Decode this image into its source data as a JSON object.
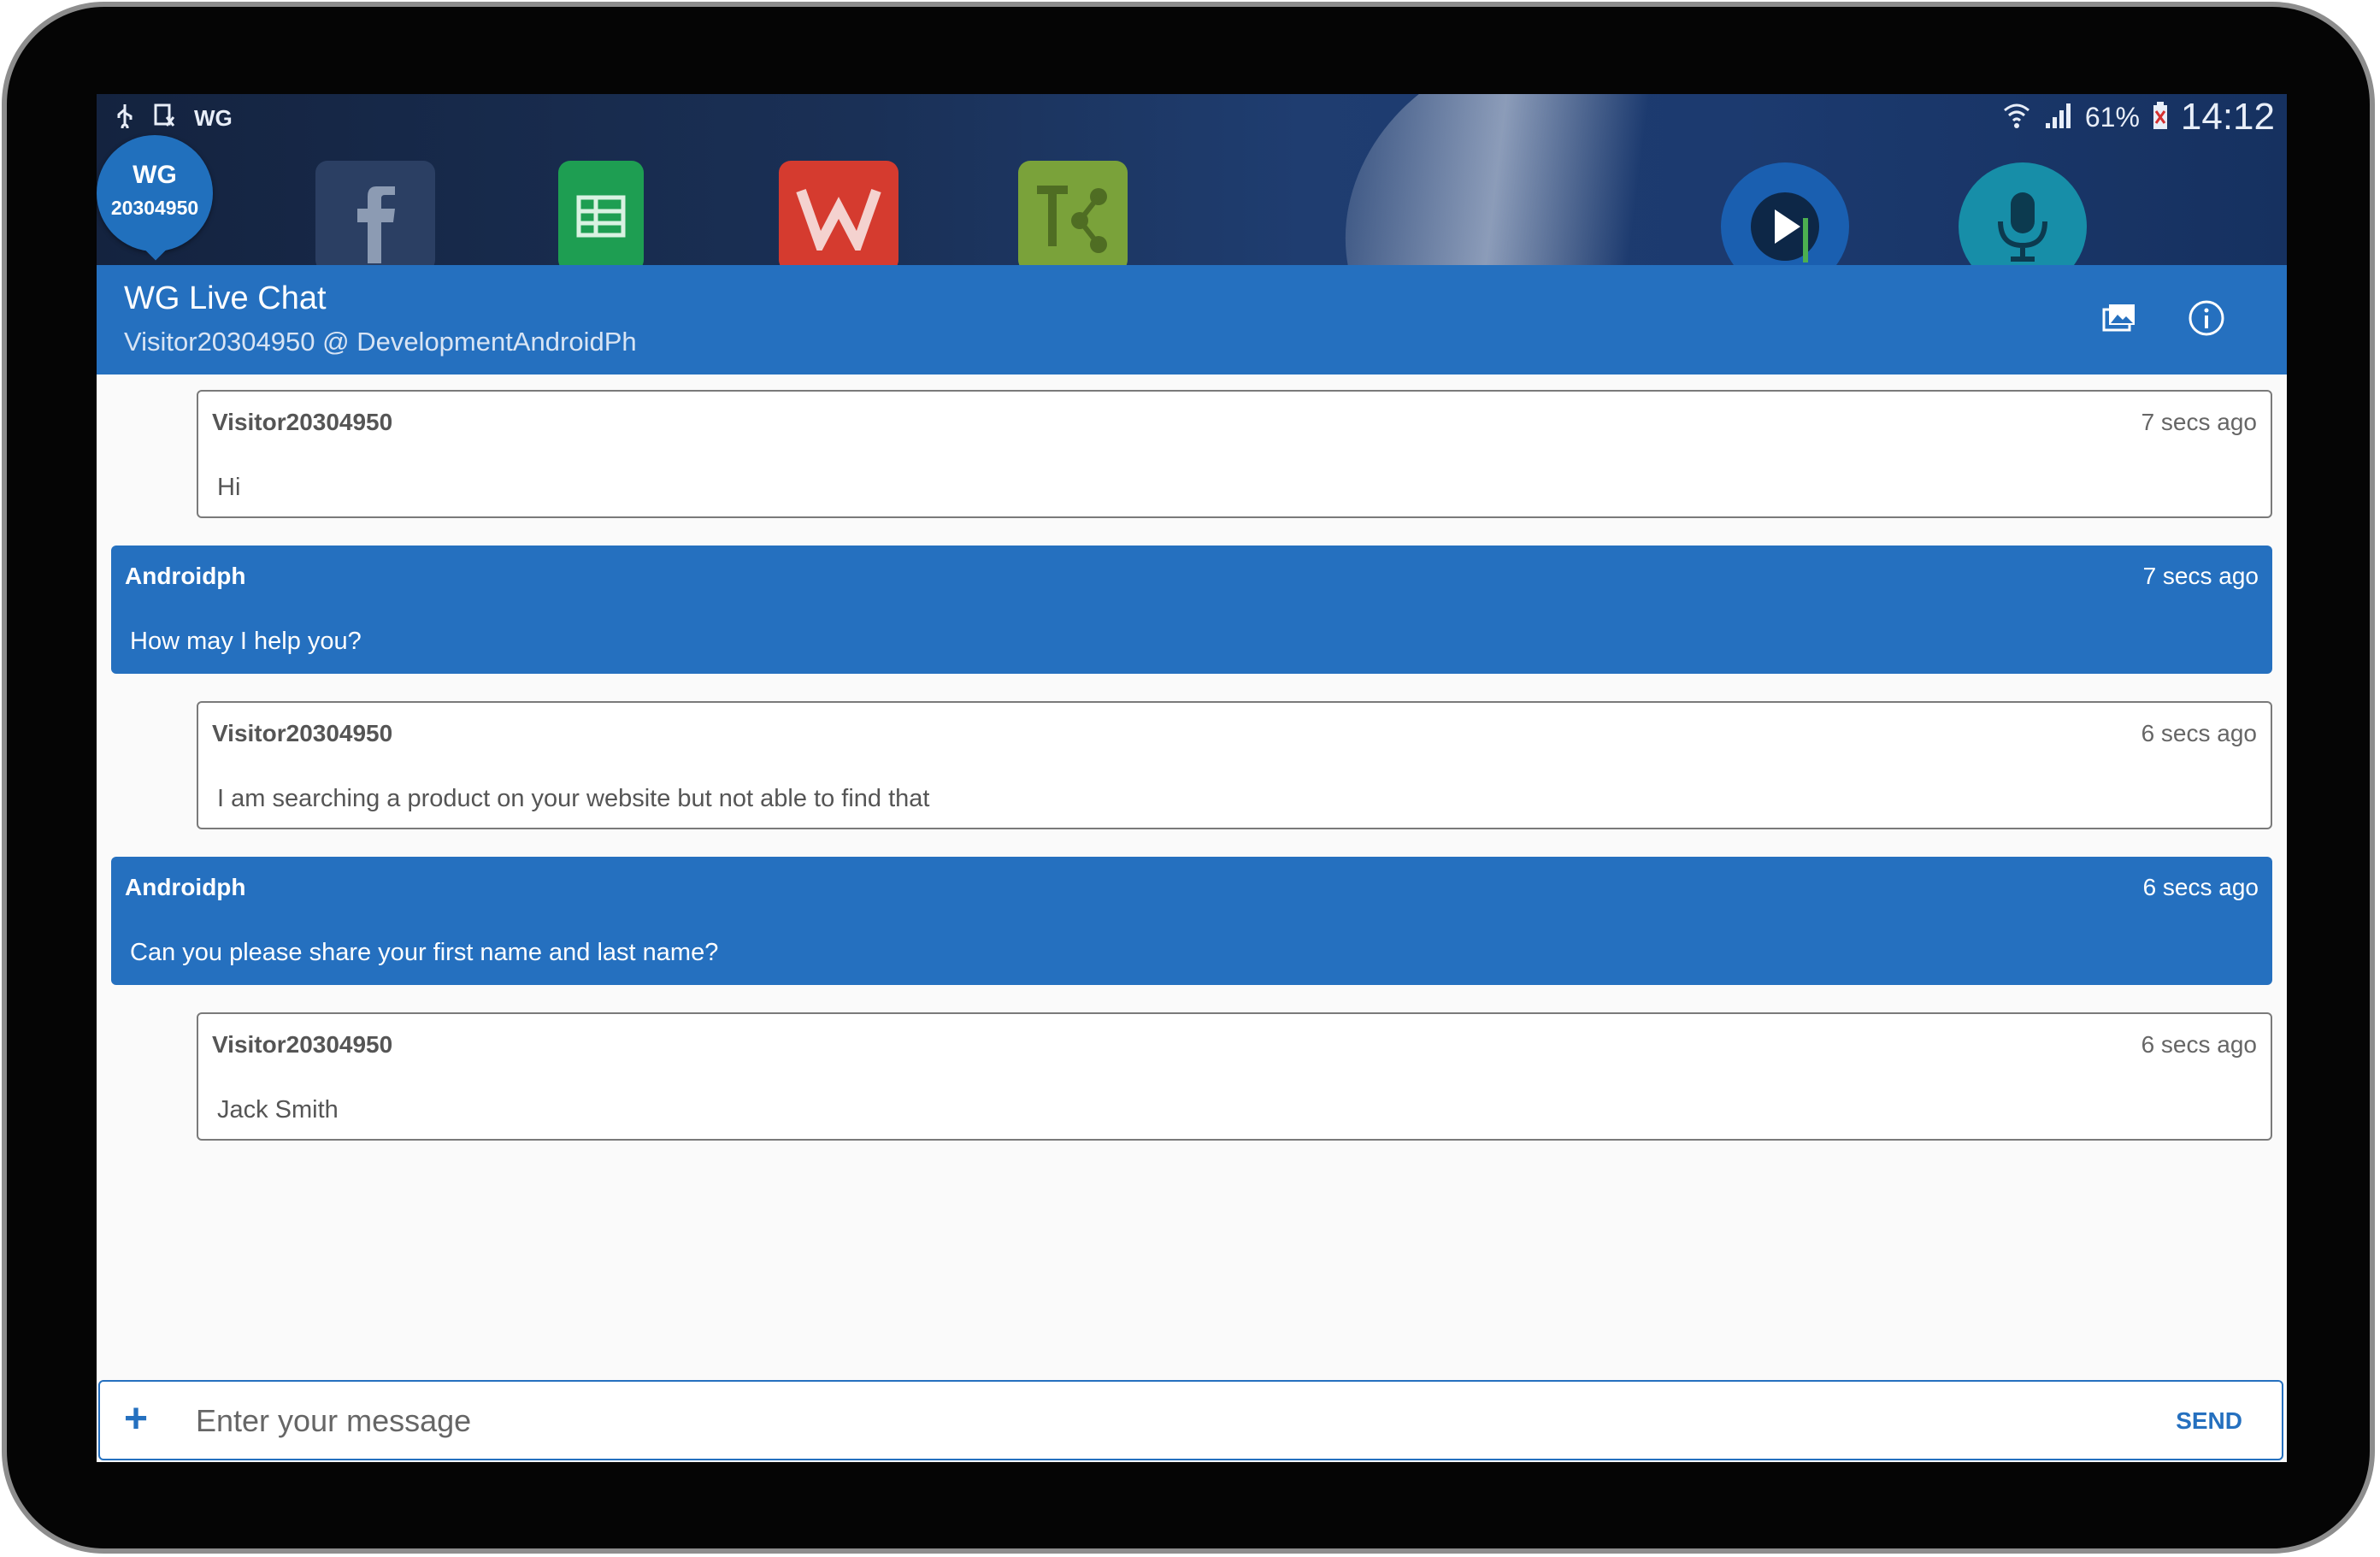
{
  "status_bar": {
    "left_icons": [
      "usb-icon",
      "sim-icon"
    ],
    "left_text": "WG",
    "battery_percent": "61%",
    "time": "14:12",
    "icons": [
      "wifi-icon",
      "signal-icon",
      "battery-icon"
    ]
  },
  "chat_head": {
    "logo": "WG",
    "number": "20304950"
  },
  "home_apps": [
    "facebook-icon",
    "sheets-icon",
    "wps-office-icon",
    "share-tool-icon",
    "music-player-icon",
    "voice-recorder-icon"
  ],
  "appbar": {
    "title": "WG Live Chat",
    "subtitle": "Visitor20304950 @ DevelopmentAndroidPh"
  },
  "messages": [
    {
      "from": "visitor",
      "sender": "Visitor20304950",
      "time": "7 secs ago",
      "text": "Hi"
    },
    {
      "from": "agent",
      "sender": "Androidph",
      "time": "7 secs ago",
      "text": "How may I help you?"
    },
    {
      "from": "visitor",
      "sender": "Visitor20304950",
      "time": "6 secs ago",
      "text": "I am searching a product on your website but not able to find that"
    },
    {
      "from": "agent",
      "sender": "Androidph",
      "time": "6 secs ago",
      "text": "Can you please share your first name and last name?"
    },
    {
      "from": "visitor",
      "sender": "Visitor20304950",
      "time": "6 secs ago",
      "text": "Jack Smith"
    }
  ],
  "composer": {
    "placeholder": "Enter your message",
    "value": "",
    "add_label": "+",
    "send_label": "SEND"
  },
  "colors": {
    "primary": "#2570bf",
    "background": "#fafafa",
    "bezel": "#050505"
  }
}
